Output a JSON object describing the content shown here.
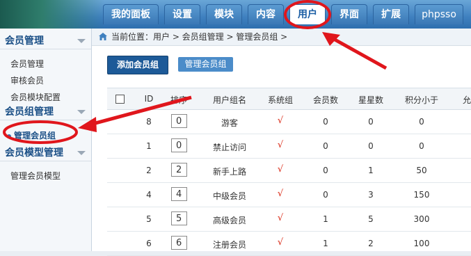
{
  "nav": {
    "tabs": [
      "我的面板",
      "设置",
      "模块",
      "内容",
      "用户",
      "界面",
      "扩展",
      "phpsso"
    ],
    "active_index": 4
  },
  "sidebar": {
    "sections": [
      {
        "title": "会员管理",
        "items": [
          "会员管理",
          "审核会员",
          "会员模块配置"
        ]
      },
      {
        "title": "会员组管理",
        "items": [
          "管理会员组"
        ]
      },
      {
        "title": "会员模型管理",
        "items": [
          "管理会员模型"
        ]
      }
    ]
  },
  "breadcrumb": {
    "text": "当前位置：用户 > 会员组管理 > 管理会员组 >"
  },
  "actions": {
    "add_group": "添加会员组",
    "manage_group": "管理会员组"
  },
  "table": {
    "headers": [
      "ID",
      "排序",
      "用户组名",
      "系统组",
      "会员数",
      "星星数",
      "积分小于",
      "允"
    ],
    "rows": [
      {
        "id": "8",
        "order": "0",
        "name": "游客",
        "system": "√",
        "members": "0",
        "stars": "0",
        "points": "0"
      },
      {
        "id": "1",
        "order": "0",
        "name": "禁止访问",
        "system": "√",
        "members": "0",
        "stars": "0",
        "points": "0"
      },
      {
        "id": "2",
        "order": "2",
        "name": "新手上路",
        "system": "√",
        "members": "0",
        "stars": "1",
        "points": "50"
      },
      {
        "id": "4",
        "order": "4",
        "name": "中级会员",
        "system": "√",
        "members": "0",
        "stars": "3",
        "points": "150"
      },
      {
        "id": "5",
        "order": "5",
        "name": "高级会员",
        "system": "√",
        "members": "1",
        "stars": "5",
        "points": "300"
      },
      {
        "id": "6",
        "order": "6",
        "name": "注册会员",
        "system": "√",
        "members": "1",
        "stars": "2",
        "points": "100"
      }
    ]
  },
  "colors": {
    "annotation_red": "#e0161c",
    "nav_blue": "#3f80bf",
    "dark_blue": "#1d5a98"
  }
}
